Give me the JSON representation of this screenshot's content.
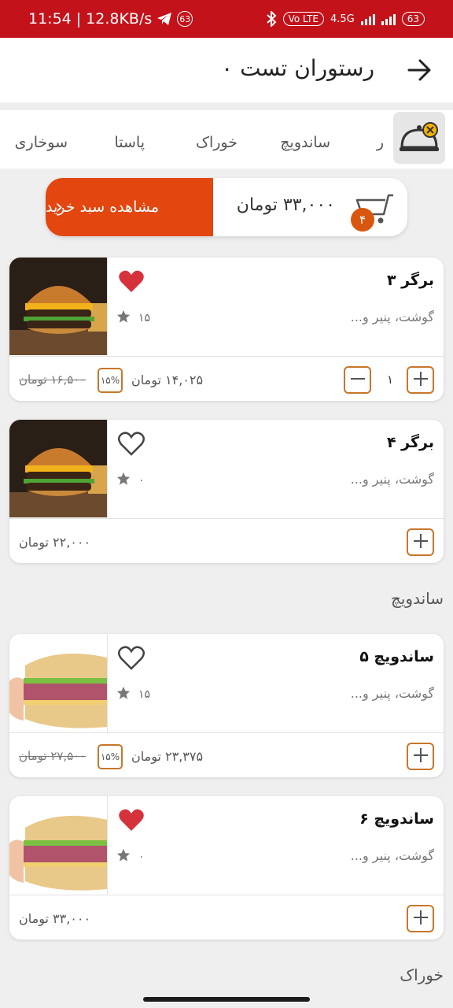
{
  "status": {
    "time": "11:54",
    "speed": "12.8KB/s",
    "notif": "63",
    "battery": "63",
    "volte": "Vo LTE",
    "net": "4.5G"
  },
  "header": {
    "title": "رستوران تست ۰"
  },
  "tabs": [
    "ر",
    "ساندویچ",
    "خوراک",
    "پاستا",
    "سوخاری"
  ],
  "cart": {
    "count": "۴",
    "total": "۳۳,۰۰۰ تومان",
    "button": "مشاهده سبد خرید"
  },
  "sections": {
    "sandwich": "ساندویچ",
    "khorak": "خوراک"
  },
  "items": [
    {
      "name": "برگر ۳",
      "desc": "گوشت، پنیر و...",
      "rating": "۱۵",
      "favorite": true,
      "price": "۱۴,۰۲۵ تومان",
      "discount": "۱۵%",
      "old_price": "۱۶,۵۰۰ تومان",
      "qty": "۱",
      "image": "burger"
    },
    {
      "name": "برگر ۴",
      "desc": "گوشت، پنیر و...",
      "rating": "۰",
      "favorite": false,
      "price": "۲۲,۰۰۰ تومان",
      "image": "burger"
    },
    {
      "name": "ساندویچ ۵",
      "desc": "گوشت، پنیر و...",
      "rating": "۱۵",
      "favorite": false,
      "price": "۲۳,۳۷۵ تومان",
      "discount": "۱۵%",
      "old_price": "۲۷,۵۰۰ تومان",
      "image": "sandwich"
    },
    {
      "name": "ساندویچ ۶",
      "desc": "گوشت، پنیر و...",
      "rating": "۰",
      "favorite": true,
      "price": "۳۳,۰۰۰ تومان",
      "image": "sandwich"
    }
  ],
  "colors": {
    "brand": "#c4121a",
    "accent": "#e3460e",
    "border": "#c8762a",
    "heart": "#d6323c"
  }
}
